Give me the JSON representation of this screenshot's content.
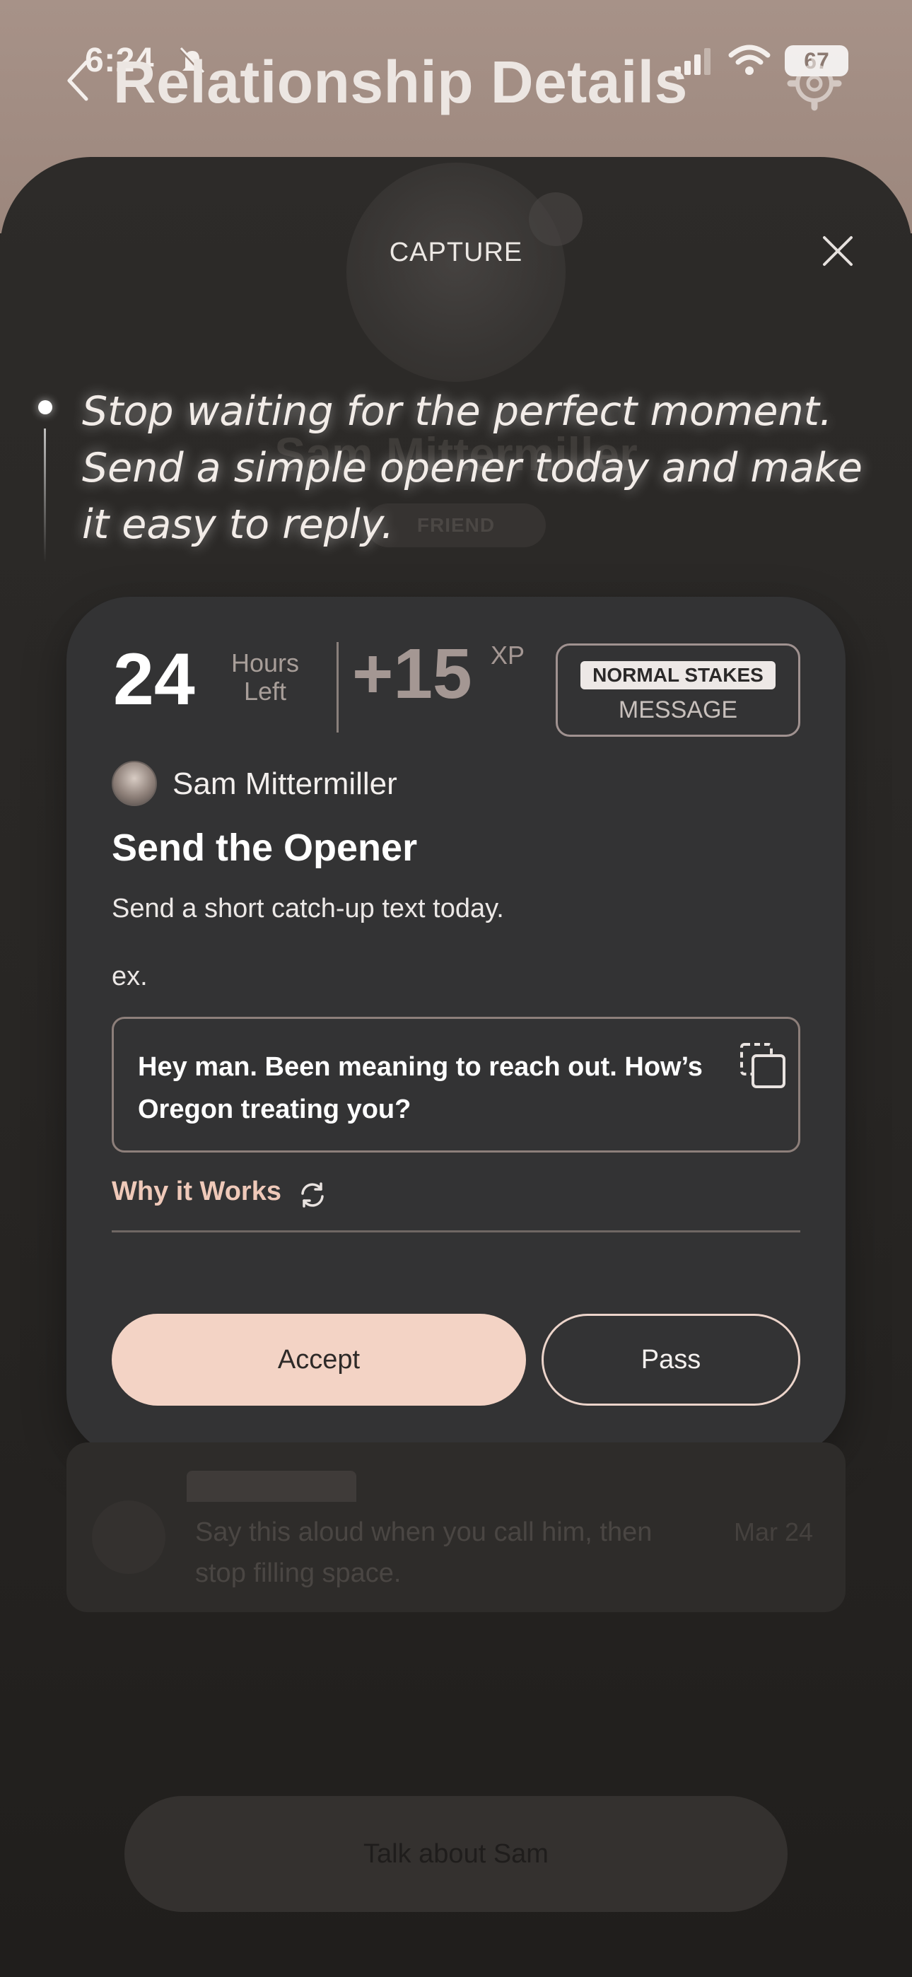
{
  "status_bar": {
    "time": "6:24",
    "battery": "67",
    "icons": [
      "bell-slash-icon",
      "signal-icon",
      "wifi-icon",
      "battery-icon"
    ]
  },
  "header": {
    "title": "Relationship Details",
    "back_icon": "chevron-left-icon",
    "settings_icon": "gear-icon"
  },
  "background_profile": {
    "name": "Sam Mittermiller",
    "relationship": "FRIEND",
    "log_tag": "",
    "log_note": "Say this aloud when you call him, then stop filling space.",
    "log_date": "Mar 24",
    "talk_button": "Talk about Sam"
  },
  "capture": {
    "label": "CAPTURE",
    "close_icon": "close-icon",
    "quote": "Stop waiting for the perfect moment. Send a simple opener today and make it easy to reply."
  },
  "card": {
    "hours_value": "24",
    "hours_label": "Hours Left",
    "xp_value": "+15",
    "xp_unit": "XP",
    "stakes": "NORMAL STAKES",
    "type": "MESSAGE",
    "person_name": "Sam Mittermiller",
    "task_title": "Send the Opener",
    "task_description": "Send a short catch-up text today.",
    "example_label": "ex.",
    "example_text": "Hey man. Been meaning to reach out. How’s Oregon treating you?",
    "copy_icon": "copy-icon",
    "why_label": "Why it Works",
    "why_icon": "refresh-icon",
    "accept_label": "Accept",
    "pass_label": "Pass"
  },
  "colors": {
    "accent": "#f3d3c5",
    "link": "#efc9b9",
    "card_bg": "#333334",
    "sheet_bg": "#2d2b29",
    "header_bg": "#a79288"
  }
}
